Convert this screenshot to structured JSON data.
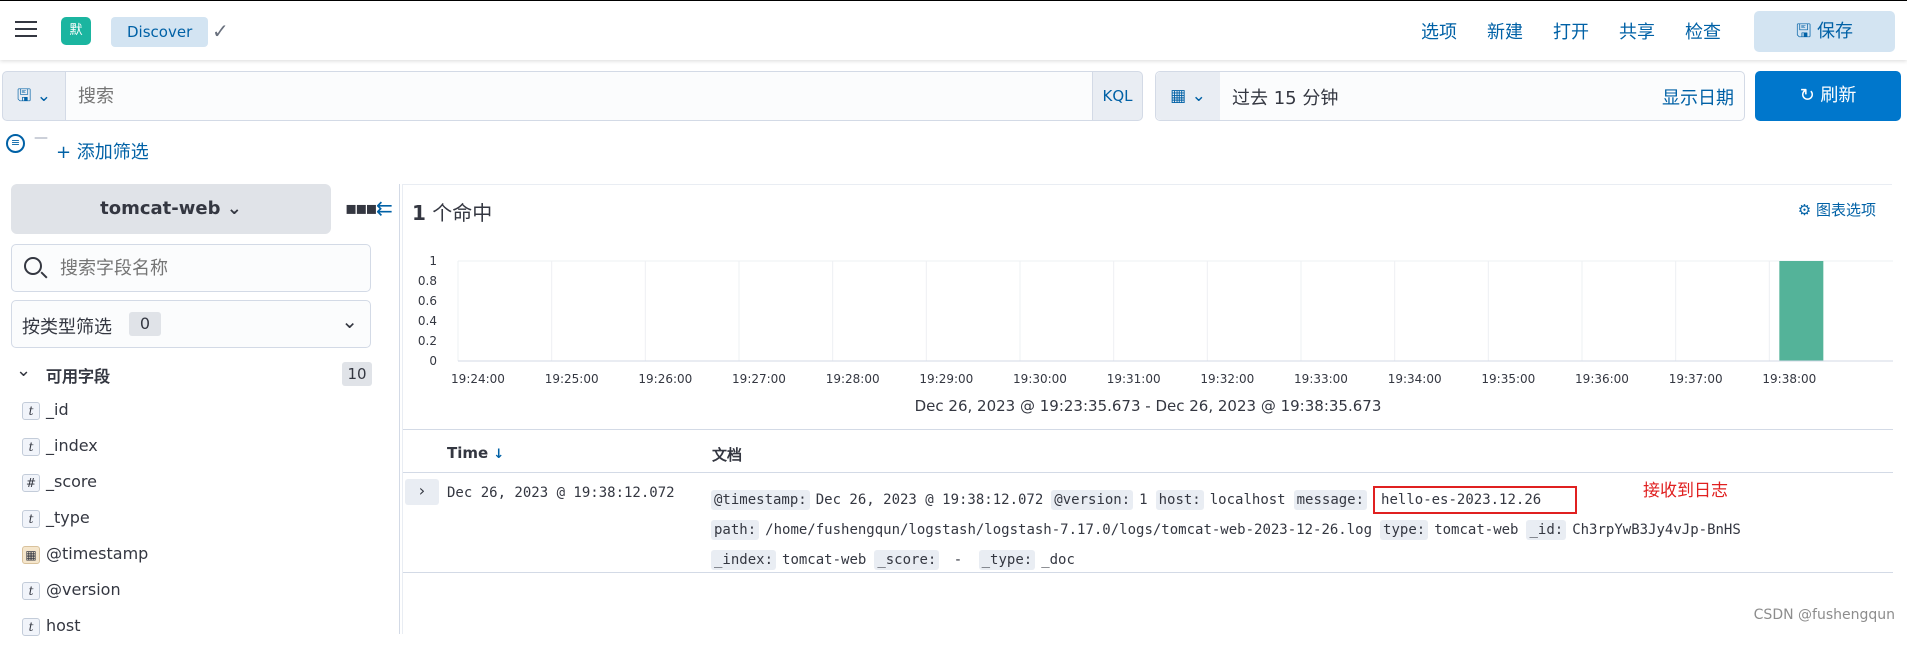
{
  "header": {
    "space_initial": "默",
    "breadcrumb": "Discover",
    "nav": [
      "选项",
      "新建",
      "打开",
      "共享",
      "检查"
    ],
    "save_label": "保存"
  },
  "query": {
    "placeholder": "搜索",
    "language": "KQL",
    "time_range": "过去 15 分钟",
    "show_dates": "显示日期",
    "refresh_label": "刷新"
  },
  "filters": {
    "add_filter": "+ 添加筛选"
  },
  "sidebar": {
    "index_pattern": "tomcat-web",
    "field_search_placeholder": "搜索字段名称",
    "type_filter_label": "按类型筛选",
    "type_filter_count": "0",
    "available_label": "可用字段",
    "available_count": "10",
    "fields": [
      {
        "type": "t",
        "name": "_id"
      },
      {
        "type": "t",
        "name": "_index"
      },
      {
        "type": "#",
        "name": "_score"
      },
      {
        "type": "t",
        "name": "_type"
      },
      {
        "type": "date",
        "name": "@timestamp"
      },
      {
        "type": "t",
        "name": "@version"
      },
      {
        "type": "t",
        "name": "host"
      }
    ]
  },
  "main": {
    "hits_count": "1",
    "hits_label": "个命中",
    "chart_options": "图表选项",
    "range_text": "Dec 26, 2023 @ 19:23:35.673 - Dec 26, 2023 @ 19:38:35.673",
    "col_time": "Time",
    "col_doc": "文档",
    "row": {
      "time": "Dec 26, 2023 @ 19:38:12.072",
      "fields": [
        {
          "k": "@timestamp:",
          "v": "Dec 26, 2023 @ 19:38:12.072"
        },
        {
          "k": "@version:",
          "v": "1"
        },
        {
          "k": "host:",
          "v": "localhost"
        },
        {
          "k": "message:",
          "v": "hello-es-2023.12.26"
        },
        {
          "k": "path:",
          "v": "/home/fushengqun/logstash/logstash-7.17.0/logs/tomcat-web-2023-12-26.log"
        },
        {
          "k": "type:",
          "v": "tomcat-web"
        },
        {
          "k": "_id:",
          "v": "Ch3rpYwB3Jy4vJp-BnHS"
        },
        {
          "k": "_index:",
          "v": "tomcat-web"
        },
        {
          "k": "_score:",
          "v": " - "
        },
        {
          "k": "_type:",
          "v": "_doc"
        }
      ]
    },
    "annotation": "接收到日志"
  },
  "watermark": "CSDN @fushengqun",
  "chart_data": {
    "type": "bar",
    "categories": [
      "19:24:00",
      "19:25:00",
      "19:26:00",
      "19:27:00",
      "19:28:00",
      "19:29:00",
      "19:30:00",
      "19:31:00",
      "19:32:00",
      "19:33:00",
      "19:34:00",
      "19:35:00",
      "19:36:00",
      "19:37:00",
      "19:38:00"
    ],
    "values": [
      0,
      0,
      0,
      0,
      0,
      0,
      0,
      0,
      0,
      0,
      0,
      0,
      0,
      0,
      1
    ],
    "yticks": [
      "0",
      "0.2",
      "0.4",
      "0.6",
      "0.8",
      "1"
    ],
    "ylim": [
      0,
      1
    ],
    "color": "#54b399",
    "now_marker_color": "#e02020",
    "grid": true
  }
}
